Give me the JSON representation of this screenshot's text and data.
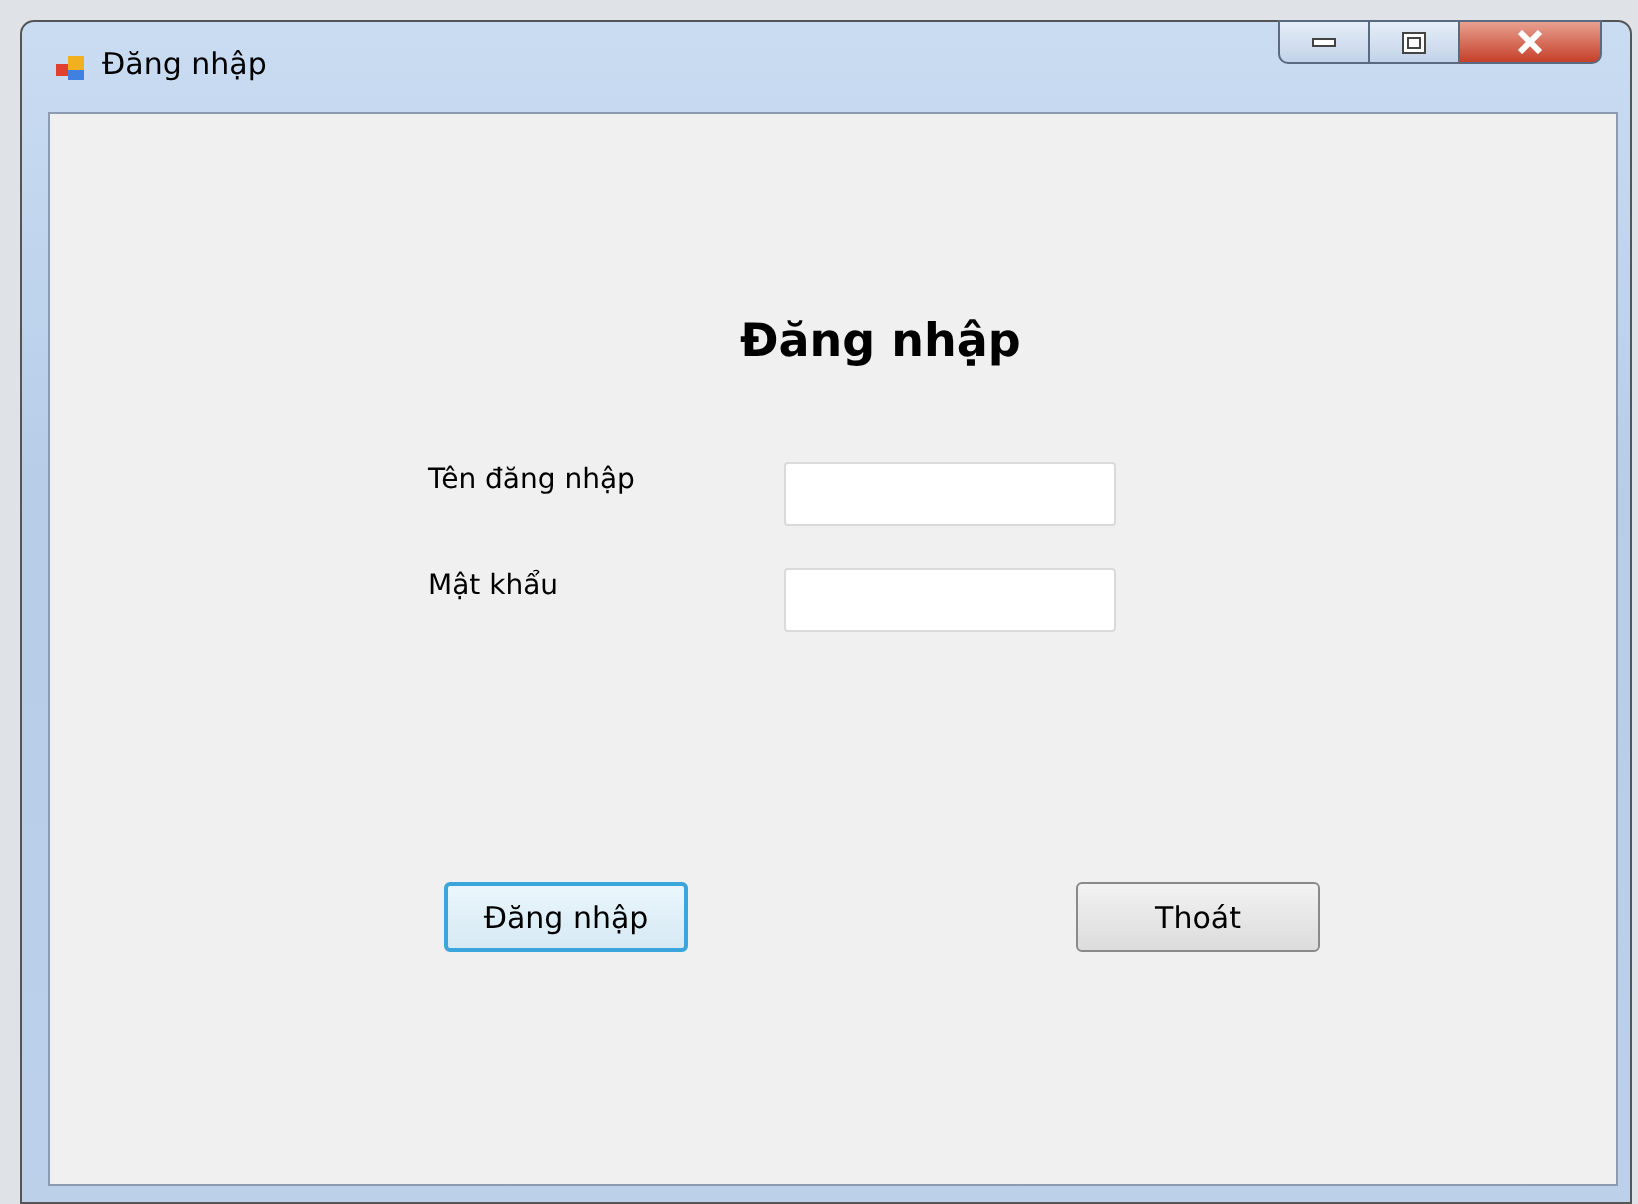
{
  "window": {
    "title": "Đăng nhập"
  },
  "heading": "Đăng nhập",
  "fields": [
    {
      "label": "Tên đăng nhập"
    },
    {
      "label": "Mật khẩu"
    }
  ],
  "buttons": [
    {
      "label": "Đăng nhập",
      "focused": true
    },
    {
      "label": "Thoát",
      "focused": false
    }
  ]
}
